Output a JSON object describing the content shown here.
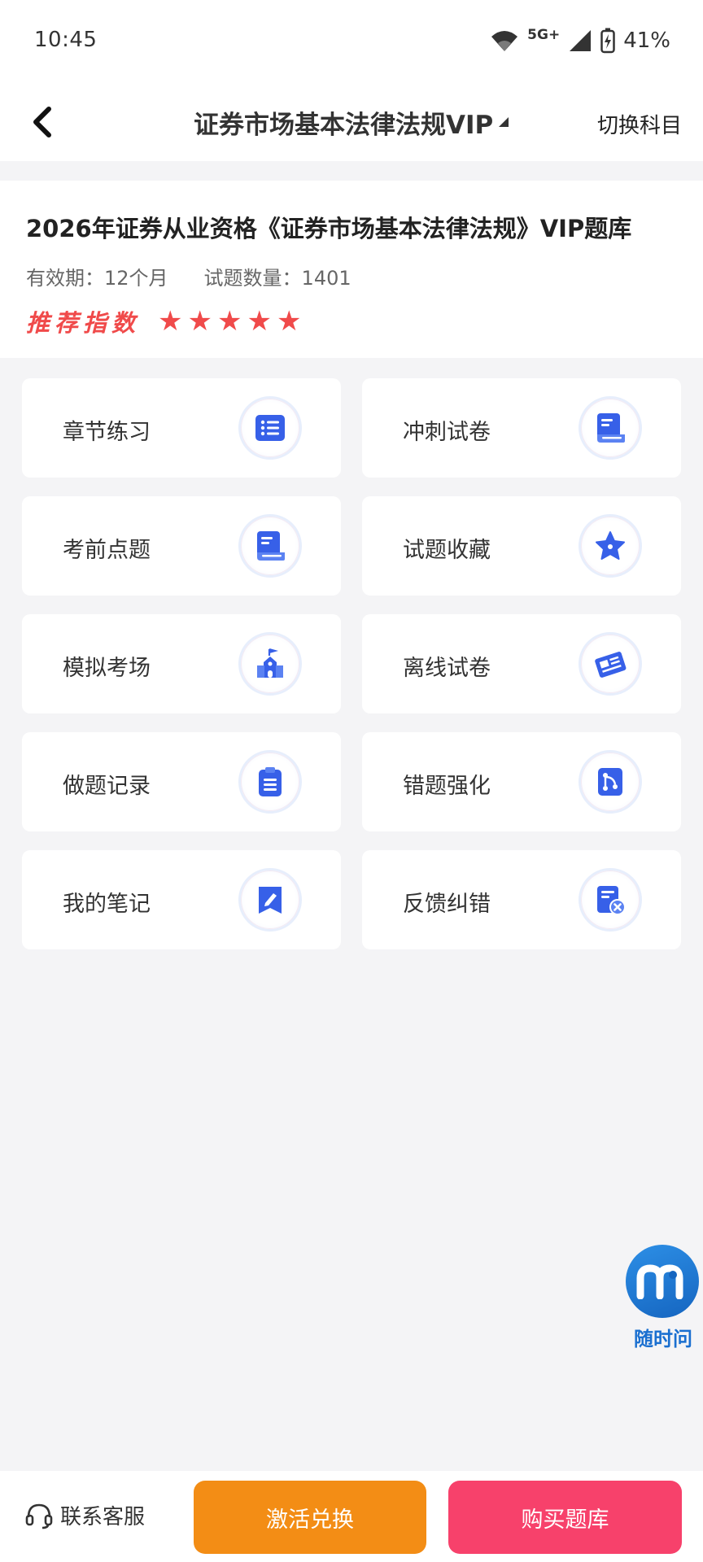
{
  "status_bar": {
    "time": "10:45",
    "network": "5G+",
    "battery": "41%"
  },
  "nav": {
    "title": "证券市场基本法律法规VIP",
    "switch_label": "切换科目"
  },
  "info": {
    "title": "2026年证券从业资格《证券市场基本法律法规》VIP题库",
    "validity": "有效期：12个月",
    "question_count": "试题数量：1401",
    "recommend_label": "推荐指数",
    "rating": 5
  },
  "tiles": [
    {
      "label": "章节练习",
      "icon": "list-icon"
    },
    {
      "label": "冲刺试卷",
      "icon": "paper-icon"
    },
    {
      "label": "考前点题",
      "icon": "paper-icon"
    },
    {
      "label": "试题收藏",
      "icon": "star-icon"
    },
    {
      "label": "模拟考场",
      "icon": "school-icon"
    },
    {
      "label": "离线试卷",
      "icon": "newspaper-icon"
    },
    {
      "label": "做题记录",
      "icon": "clipboard-icon"
    },
    {
      "label": "错题强化",
      "icon": "git-icon"
    },
    {
      "label": "我的笔记",
      "icon": "note-edit-icon"
    },
    {
      "label": "反馈纠错",
      "icon": "feedback-icon"
    }
  ],
  "assistant": {
    "label": "随时问"
  },
  "bottom": {
    "service_label": "联系客服",
    "activate_label": "激活兑换",
    "buy_label": "购买题库"
  },
  "colors": {
    "accent_blue": "#3760e8",
    "recommend_red": "#f04a4a",
    "activate_orange": "#f38d15",
    "buy_pink": "#f7416b"
  }
}
